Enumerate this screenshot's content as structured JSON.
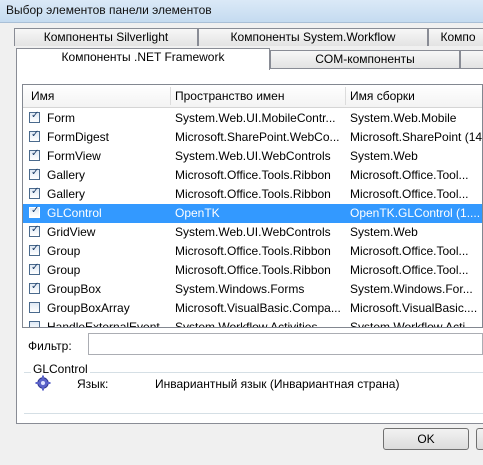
{
  "window": {
    "title": "Выбор элементов панели элементов"
  },
  "tabs_back": [
    {
      "label": "Компоненты Silverlight"
    },
    {
      "label": "Компоненты System.Workflow"
    },
    {
      "label": "Компо"
    }
  ],
  "tabs_front": [
    {
      "label": "Компоненты .NET Framework",
      "active": true
    },
    {
      "label": "COM-компоненты"
    },
    {
      "label": ""
    }
  ],
  "table": {
    "columns": [
      "Имя",
      "Пространство имен",
      "Имя сборки"
    ],
    "rows": [
      {
        "checked": true,
        "name": "Form",
        "namespace": "System.Web.UI.MobileContr...",
        "assembly": "System.Web.Mobile"
      },
      {
        "checked": true,
        "name": "FormDigest",
        "namespace": "Microsoft.SharePoint.WebCo...",
        "assembly": "Microsoft.SharePoint (14..."
      },
      {
        "checked": true,
        "name": "FormView",
        "namespace": "System.Web.UI.WebControls",
        "assembly": "System.Web"
      },
      {
        "checked": true,
        "name": "Gallery",
        "namespace": "Microsoft.Office.Tools.Ribbon",
        "assembly": "Microsoft.Office.Tool..."
      },
      {
        "checked": true,
        "name": "Gallery",
        "namespace": "Microsoft.Office.Tools.Ribbon",
        "assembly": "Microsoft.Office.Tool..."
      },
      {
        "checked": true,
        "name": "GLControl",
        "namespace": "OpenTK",
        "assembly": "OpenTK.GLControl (1....",
        "selected": true
      },
      {
        "checked": true,
        "name": "GridView",
        "namespace": "System.Web.UI.WebControls",
        "assembly": "System.Web"
      },
      {
        "checked": true,
        "name": "Group",
        "namespace": "Microsoft.Office.Tools.Ribbon",
        "assembly": "Microsoft.Office.Tool..."
      },
      {
        "checked": true,
        "name": "Group",
        "namespace": "Microsoft.Office.Tools.Ribbon",
        "assembly": "Microsoft.Office.Tool..."
      },
      {
        "checked": true,
        "name": "GroupBox",
        "namespace": "System.Windows.Forms",
        "assembly": "System.Windows.For..."
      },
      {
        "checked": false,
        "name": "GroupBoxArray",
        "namespace": "Microsoft.VisualBasic.Compa...",
        "assembly": "Microsoft.VisualBasic...."
      },
      {
        "checked": false,
        "name": "HandleExternalEvent",
        "namespace": "System.Workflow.Activities",
        "assembly": "System.Workflow.Acti..."
      }
    ]
  },
  "filter": {
    "label": "Фильтр:",
    "value": ""
  },
  "info": {
    "title": "GLControl",
    "language_label": "Язык:",
    "language_value": "Инвариантный язык (Инвариантная страна)",
    "icon": "gear-icon"
  },
  "buttons": {
    "ok": "OK"
  },
  "colors": {
    "selection": "#3399ff"
  }
}
